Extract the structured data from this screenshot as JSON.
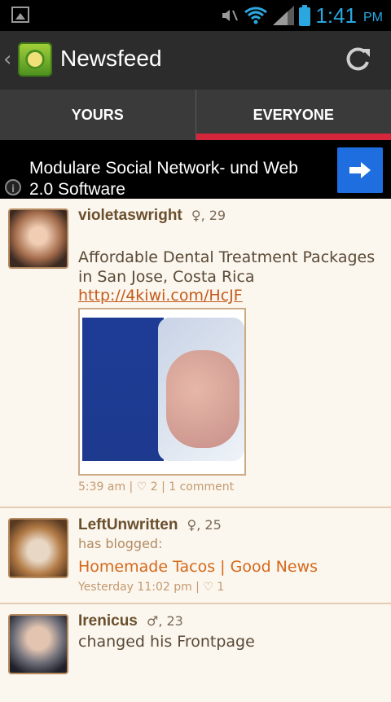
{
  "status_bar": {
    "time": "1:41",
    "ampm": "PM",
    "icons": [
      "image-icon",
      "mute-icon",
      "wifi-icon",
      "signal-icon",
      "battery-icon"
    ]
  },
  "action_bar": {
    "title": "Newsfeed",
    "icons": [
      "back-chevron-icon",
      "app-logo-icon",
      "refresh-icon"
    ]
  },
  "tabs": [
    {
      "label": "YOURS",
      "active": false
    },
    {
      "label": "EVERYONE",
      "active": true
    }
  ],
  "ad": {
    "text": "Modulare Social Network- und Web 2.0 Software",
    "icons": [
      "info-icon",
      "arrow-right-icon"
    ]
  },
  "feed": [
    {
      "username": "violetaswright",
      "gender_symbol": "♀",
      "age": ", 29",
      "text": "Affordable Dental Treatment Packages in San Jose, Costa Rica",
      "link": "http://4kiwi.com/HcJF",
      "meta": "5:39 am | ♡ 2 | 1 comment"
    },
    {
      "username": "LeftUnwritten",
      "gender_symbol": "♀",
      "age": ", 25",
      "subtitle": "has blogged:",
      "blog_title": "Homemade Tacos | Good News",
      "meta": "Yesterday 11:02 pm | ♡ 1"
    },
    {
      "username": "Irenicus",
      "gender_symbol": "♂",
      "age": ", 23",
      "text": "changed his Frontpage"
    }
  ]
}
